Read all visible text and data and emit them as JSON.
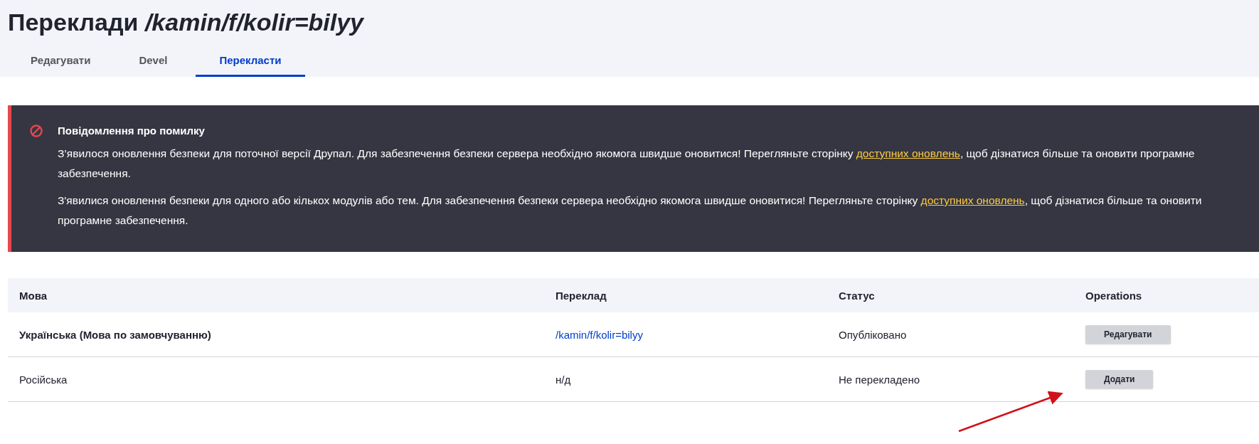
{
  "page": {
    "title": "Переклади */kamin/f/kolir=bilyy*"
  },
  "tabs": [
    {
      "label": "Редагувати",
      "selected": false
    },
    {
      "label": "Devel",
      "selected": false
    },
    {
      "label": "Перекласти",
      "selected": true
    }
  ],
  "alert": {
    "title": "Повідомлення про помилку",
    "paragraphs": [
      {
        "before": "З’явилося оновлення безпеки для поточної версії Друпал. Для забезпечення безпеки сервера необхідно якомога швидше оновитися! Перегляньте сторінку ",
        "link": "доступних оновлень",
        "after": ", щоб дізнатися більше та оновити програмне забезпечення."
      },
      {
        "before": "З'явилися оновлення безпеки для одного або кількох модулів або тем. Для забезпечення безпеки сервера необхідно якомога швидше оновитися! Перегляньте сторінку ",
        "link": "доступних оновлень",
        "after": ", щоб дізнатися більше та оновити програмне забезпечення."
      }
    ]
  },
  "table": {
    "columns": [
      "Мова",
      "Переклад",
      "Статус",
      "Operations"
    ],
    "rows": [
      {
        "language": "Українська (Мова по замовчуванню)",
        "default": true,
        "translation": "/kamin/f/kolir=bilyy",
        "kind": "link",
        "status": "Опубліковано",
        "operation": "Редагувати"
      },
      {
        "language": "Російська",
        "default": false,
        "translation": "н/д",
        "kind": "text",
        "status": "Не перекладено",
        "operation": "Додати"
      }
    ]
  }
}
